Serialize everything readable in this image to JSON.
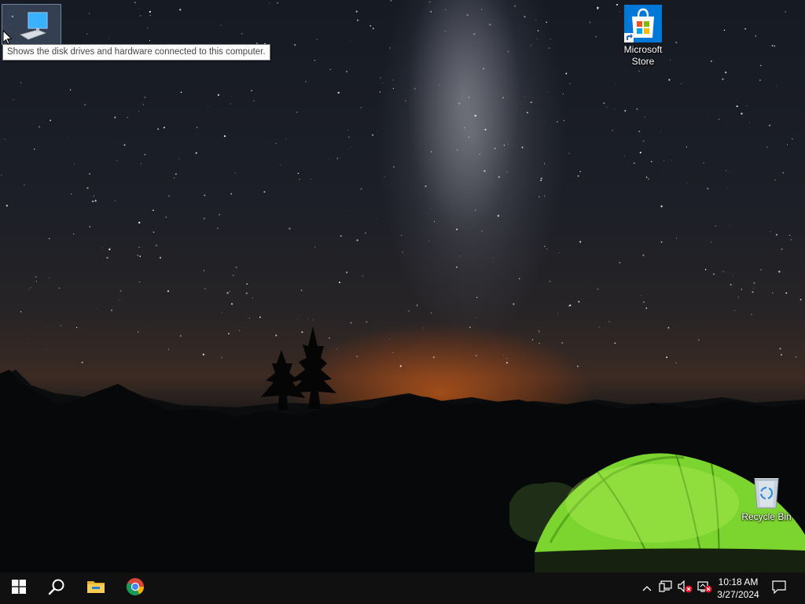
{
  "desktop": {
    "icons": [
      {
        "id": "this-pc",
        "label": "",
        "icon": "computer-monitor-icon"
      },
      {
        "id": "microsoft-store",
        "label": "Microsoft Store",
        "label_line1": "Microsoft",
        "label_line2": "Store",
        "icon": "store-bag-icon"
      },
      {
        "id": "recycle-bin",
        "label": "Recycle Bin",
        "icon": "recycle-bin-icon"
      }
    ],
    "tooltip": "Shows the disk drives and hardware connected to this computer."
  },
  "taskbar": {
    "pinned": [
      {
        "name": "Start",
        "icon": "windows-logo-icon"
      },
      {
        "name": "Search",
        "icon": "search-icon"
      },
      {
        "name": "File Explorer",
        "icon": "folder-icon"
      },
      {
        "name": "Google Chrome",
        "icon": "chrome-icon"
      }
    ],
    "tray": {
      "icons": [
        "chevron-up-icon",
        "network-icon",
        "volume-muted-icon",
        "network-error-icon"
      ],
      "time": "10:18 AM",
      "date": "3/27/2024",
      "notifications_icon": "notification-icon"
    }
  },
  "colors": {
    "taskbar": "#101010",
    "accent_blue": "#0078d7",
    "tent_green": "#8ee03a",
    "horizon_orange": "#ff6a14"
  }
}
